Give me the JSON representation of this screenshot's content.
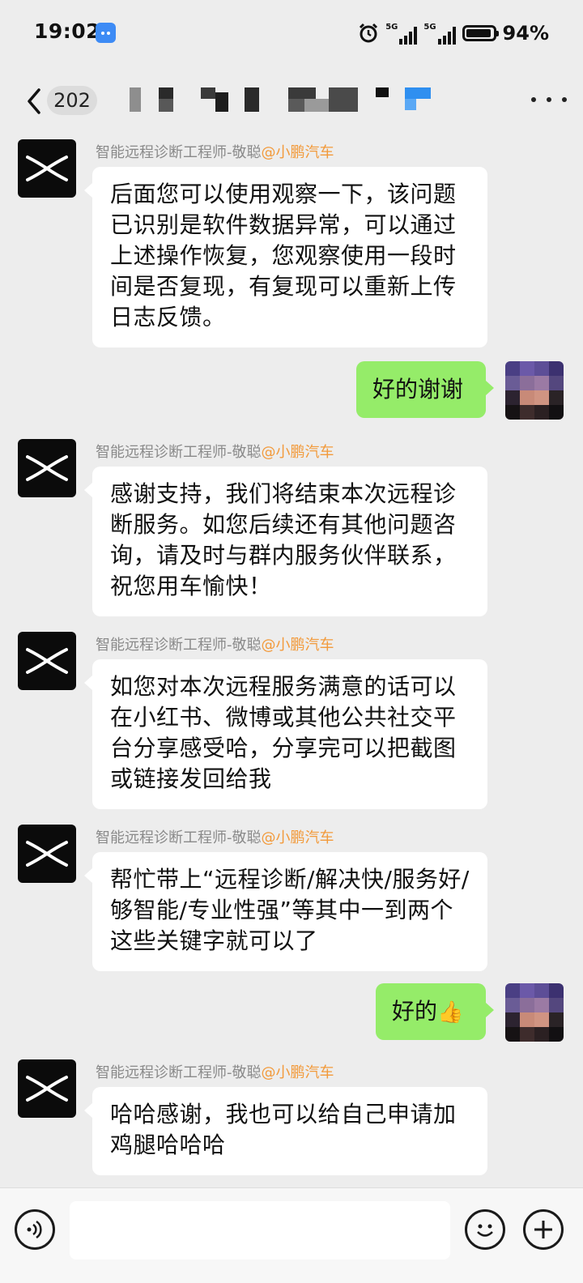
{
  "status_bar": {
    "time": "19:02",
    "network_1": "5G",
    "network_2": "5G",
    "battery_percent": "94%",
    "battery_level": 0.94,
    "icons": [
      "app-notification-icon",
      "alarm-icon",
      "signal-icon",
      "signal-icon",
      "battery-icon"
    ]
  },
  "nav": {
    "unread_count": "202",
    "back_icon": "back-chevron-icon",
    "more_icon": "more-dots-icon"
  },
  "messages": [
    {
      "type": "incoming",
      "sender_name": "智能远程诊断工程师-敬聪",
      "sender_org": "@小鹏汽车",
      "text": "后面您可以使用观察一下，该问题已识别是软件数据异常，可以通过上述操作恢复，您观察使用一段时间是否复现，有复现可以重新上传日志反馈。"
    },
    {
      "type": "outgoing",
      "text": "好的谢谢"
    },
    {
      "type": "incoming",
      "sender_name": "智能远程诊断工程师-敬聪",
      "sender_org": "@小鹏汽车",
      "text": "感谢支持，我们将结束本次远程诊断服务。如您后续还有其他问题咨询，请及时与群内服务伙伴联系，祝您用车愉快！"
    },
    {
      "type": "incoming",
      "sender_name": "智能远程诊断工程师-敬聪",
      "sender_org": "@小鹏汽车",
      "text": "如您对本次远程服务满意的话可以在小红书、微博或其他公共社交平台分享感受哈，分享完可以把截图或链接发回给我"
    },
    {
      "type": "incoming",
      "sender_name": "智能远程诊断工程师-敬聪",
      "sender_org": "@小鹏汽车",
      "text": "帮忙带上“远程诊断/解决快/服务好/够智能/专业性强”等其中一到两个这些关键字就可以了"
    },
    {
      "type": "outgoing",
      "text": "好的",
      "emoji": "👍"
    },
    {
      "type": "incoming",
      "sender_name": "智能远程诊断工程师-敬聪",
      "sender_org": "@小鹏汽车",
      "text": "哈哈感谢，我也可以给自己申请加鸡腿哈哈哈"
    }
  ],
  "input_bar": {
    "value": "",
    "icons": [
      "voice-icon",
      "emoji-icon",
      "plus-icon"
    ]
  },
  "colors": {
    "background": "#ededed",
    "outgoing_bubble": "#95ec69",
    "incoming_bubble": "#ffffff",
    "sender_org": "#f29a3b"
  }
}
